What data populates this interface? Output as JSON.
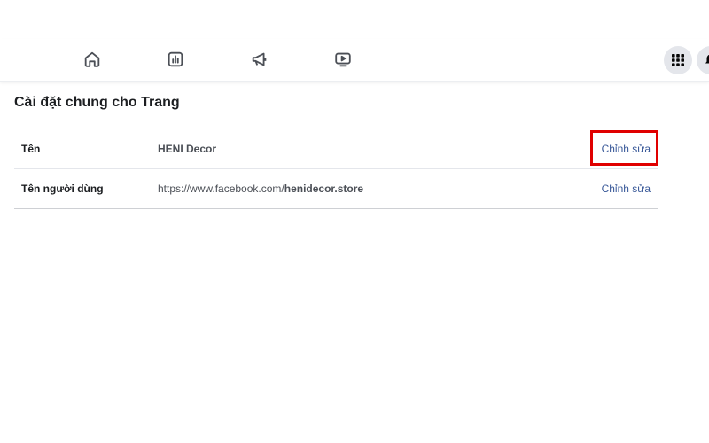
{
  "nav": {
    "icons": [
      "home-icon",
      "insights-icon",
      "megaphone-icon",
      "video-icon"
    ],
    "right": [
      "grid-menu-icon",
      "notification-icon"
    ]
  },
  "page": {
    "title": "Cài đặt chung cho Trang"
  },
  "settings": {
    "rows": [
      {
        "label": "Tên",
        "value": "HENI Decor",
        "action": "Chỉnh sửa"
      },
      {
        "label": "Tên người dùng",
        "value_prefix": "https://www.facebook.com/",
        "value_strong": "henidecor.store",
        "action": "Chỉnh sửa"
      }
    ]
  },
  "colors": {
    "link": "#385898",
    "highlight": "#e00000",
    "icon": "#65676b"
  }
}
